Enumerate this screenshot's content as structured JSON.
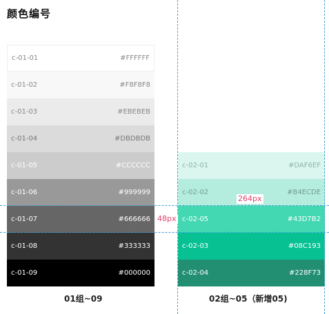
{
  "page": {
    "title": "颜色编号"
  },
  "group1": {
    "caption": "01组~09",
    "swatches": [
      {
        "code": "c-01-01",
        "hex": "#FFFFFF",
        "color": "#FFFFFF",
        "text_color": "#888888"
      },
      {
        "code": "c-01-02",
        "hex": "#F8F8F8",
        "color": "#F8F8F8",
        "text_color": "#888888"
      },
      {
        "code": "c-01-03",
        "hex": "#EBEBEB",
        "color": "#EBEBEB",
        "text_color": "#888888"
      },
      {
        "code": "c-01-04",
        "hex": "#DBDBDB",
        "color": "#DBDBDB",
        "text_color": "#777777"
      },
      {
        "code": "c-01-05",
        "hex": "#CCCCCC",
        "color": "#CCCCCC",
        "text_color": "#ffffff"
      },
      {
        "code": "c-01-06",
        "hex": "#999999",
        "color": "#999999",
        "text_color": "#ffffff"
      },
      {
        "code": "c-01-07",
        "hex": "#666666",
        "color": "#666666",
        "text_color": "#ffffff"
      },
      {
        "code": "c-01-08",
        "hex": "#333333",
        "color": "#333333",
        "text_color": "#ffffff"
      },
      {
        "code": "c-01-09",
        "hex": "#000000",
        "color": "#000000",
        "text_color": "#ffffff"
      }
    ]
  },
  "group2": {
    "caption": "02组~05（新增05)",
    "swatches": [
      {
        "code": "c-02-01",
        "hex": "#DAF6EF",
        "color": "#DAF6EF",
        "text_color": "#8fb3aa"
      },
      {
        "code": "c-02-02",
        "hex": "#B4ECDE",
        "color": "#B4ECDE",
        "text_color": "#6f9e92"
      },
      {
        "code": "c-02-05",
        "hex": "#43D7B2",
        "color": "#43D7B2",
        "text_color": "#ffffff"
      },
      {
        "code": "c-02-03",
        "hex": "#08C193",
        "color": "#08C193",
        "text_color": "#ffffff"
      },
      {
        "code": "c-02-04",
        "hex": "#228F73",
        "color": "#228F73",
        "text_color": "#ffffff"
      }
    ]
  },
  "measurements": {
    "height_label": "48px",
    "width_label": "264px"
  },
  "guide_color": "#3aa0d8"
}
